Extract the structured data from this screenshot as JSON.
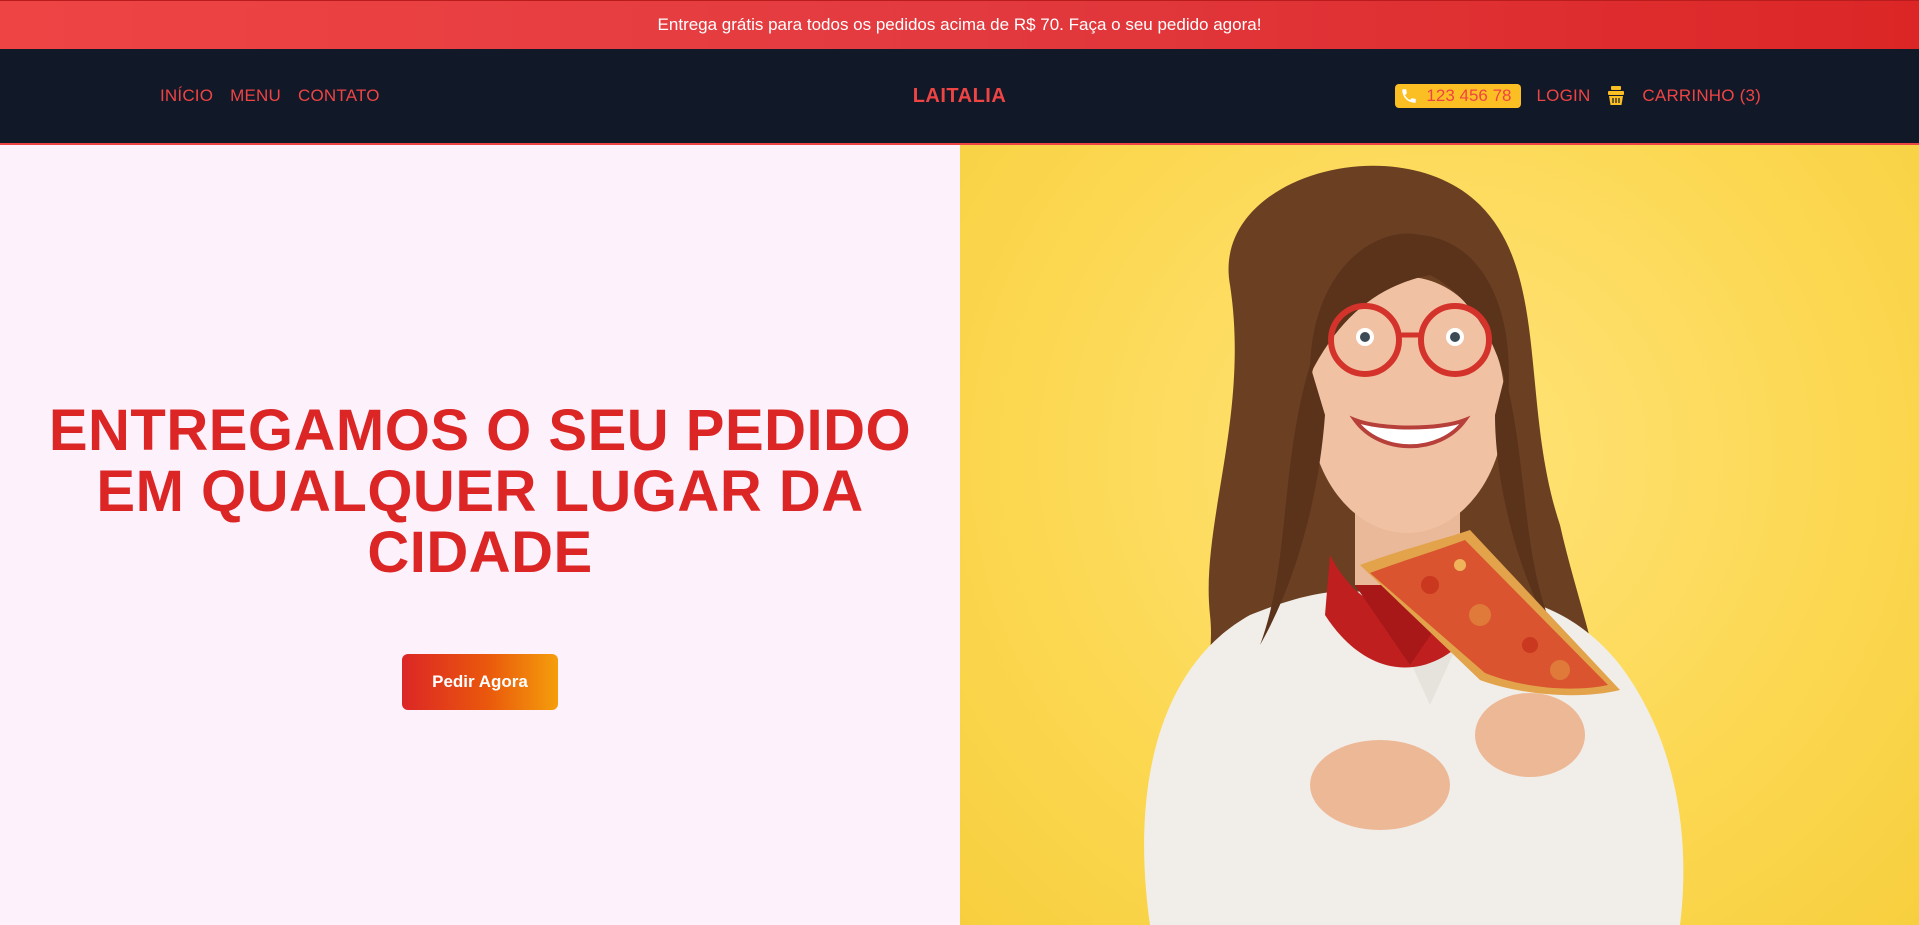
{
  "promo": {
    "text": "Entrega grátis para todos os pedidos acima de R$ 70. Faça o seu pedido agora!"
  },
  "nav": {
    "links": [
      "INÍCIO",
      "MENU",
      "CONTATO"
    ],
    "brand": "LAITALIA",
    "phone": "123 456 78",
    "login": "LOGIN",
    "cart": "CARRINHO (3)"
  },
  "hero": {
    "title": "ENTREGAMOS O SEU PEDIDO EM QUALQUER LUGAR DA CIDADE",
    "cta_label": "Pedir Agora",
    "image_icon": "woman-eating-pizza-photo"
  },
  "colors": {
    "primary_red": "#ef4444",
    "title_red": "#dc2626",
    "navbar_bg": "#111827",
    "phone_bg": "#fbbf24",
    "hero_left_bg": "#fdf2fc",
    "hero_right_bg": "#fcd852"
  }
}
